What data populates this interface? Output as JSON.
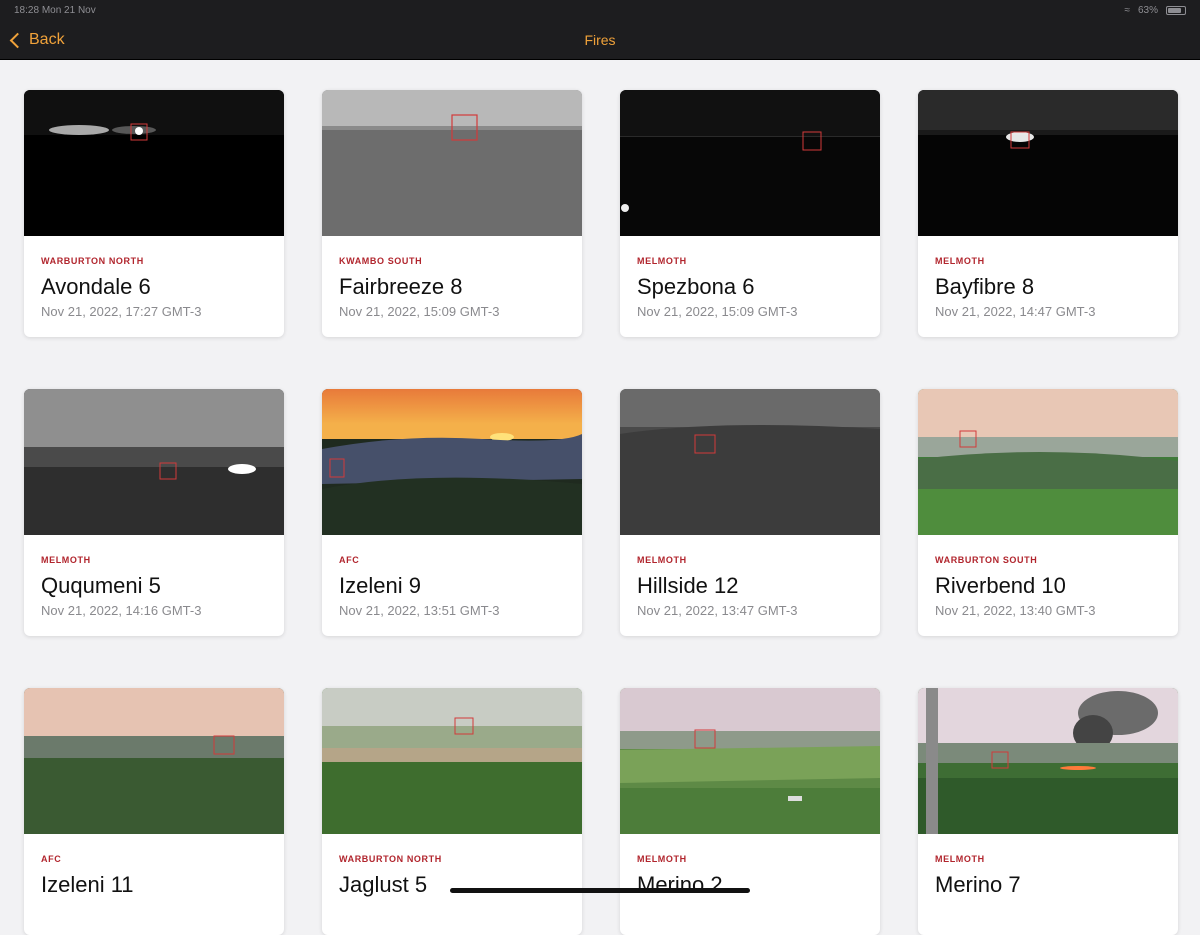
{
  "status": {
    "time": "18:28",
    "date": "Mon 21 Nov",
    "battery": "63%"
  },
  "nav": {
    "back_label": "Back",
    "title": "Fires",
    "accent": "#f0a23a"
  },
  "cards": [
    {
      "region": "WARBURTON NORTH",
      "name": "Avondale 6",
      "date": "Nov 21, 2022, 17:27 GMT-3",
      "scene": "night-lights"
    },
    {
      "region": "KWAMBO SOUTH",
      "name": "Fairbreeze 8",
      "date": "Nov 21, 2022, 15:09 GMT-3",
      "scene": "gray-plain"
    },
    {
      "region": "MELMOTH",
      "name": "Spezbona 6",
      "date": "Nov 21, 2022, 15:09 GMT-3",
      "scene": "night-dark"
    },
    {
      "region": "MELMOTH",
      "name": "Bayfibre 8",
      "date": "Nov 21, 2022, 14:47 GMT-3",
      "scene": "night-glow"
    },
    {
      "region": "MELMOTH",
      "name": "Ququmeni 5",
      "date": "Nov 21, 2022, 14:16 GMT-3",
      "scene": "night-gray"
    },
    {
      "region": "AFC",
      "name": "Izeleni 9",
      "date": "Nov 21, 2022, 13:51 GMT-3",
      "scene": "sunset"
    },
    {
      "region": "MELMOTH",
      "name": "Hillside 12",
      "date": "Nov 21, 2022, 13:47 GMT-3",
      "scene": "gray-hills"
    },
    {
      "region": "WARBURTON SOUTH",
      "name": "Riverbend 10",
      "date": "Nov 21, 2022, 13:40 GMT-3",
      "scene": "dusk-fields"
    },
    {
      "region": "AFC",
      "name": "Izeleni 11",
      "date": "",
      "scene": "dusk-forest"
    },
    {
      "region": "WARBURTON NORTH",
      "name": "Jaglust 5",
      "date": "",
      "scene": "green-forest"
    },
    {
      "region": "MELMOTH",
      "name": "Merino 2",
      "date": "",
      "scene": "farmland"
    },
    {
      "region": "MELMOTH",
      "name": "Merino 7",
      "date": "",
      "scene": "smoke"
    }
  ],
  "colors": {
    "region_text": "#b1252d",
    "marker": "#d23a3a"
  }
}
